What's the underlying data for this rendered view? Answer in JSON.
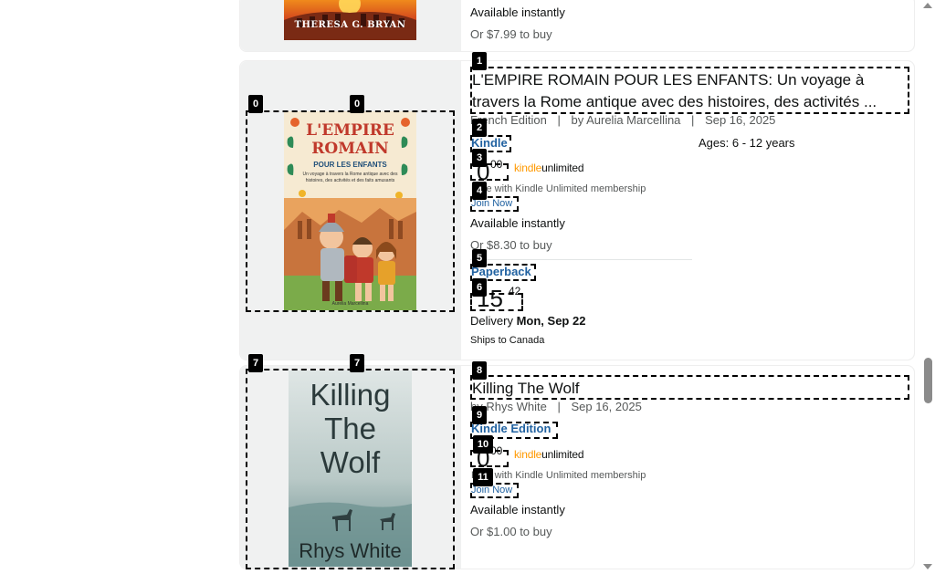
{
  "colors": {
    "link": "#2162a1",
    "ku_orange": "#ff9900",
    "annotation": "#000000"
  },
  "top_card": {
    "cover_author": "THERESA G. BRYAN",
    "availability": "Available instantly",
    "buy_line": "Or $7.99 to buy"
  },
  "card1": {
    "cover": {
      "title_l1": "L'EMPIRE",
      "title_l2": "ROMAIN",
      "subtitle": "POUR LES ENFANTS",
      "blurb": "Un voyage à travers la Rome antique avec des histoires, des activités et des faits amusants",
      "author": "Aurelia Marcellina"
    },
    "title": "L'EMPIRE ROMAIN POUR LES ENFANTS: Un voyage à travers la Rome antique avec des histoires, des activités ...",
    "edition": "French Edition",
    "sep": "|",
    "by_author": "by Aurelia Marcellina",
    "date": "Sep 16, 2025",
    "ages": "Ages: 6 - 12 years",
    "format1": "Kindle",
    "price1_whole": "0",
    "price1_frac": "00",
    "ku_kindle": "kindle",
    "ku_unlimited": "unlimited",
    "ku_note": "Free with Kindle Unlimited membership",
    "join": "Join Now",
    "availability": "Available instantly",
    "buy_line": "Or $8.30 to buy",
    "format2": "Paperback",
    "price2_whole": "15",
    "price2_frac": "42",
    "delivery_label": "Delivery",
    "delivery_date": "Mon, Sep 22",
    "ships": "Ships to Canada"
  },
  "card2": {
    "cover": {
      "title_l1": "Killing",
      "title_l2": "The",
      "title_l3": "Wolf",
      "author": "Rhys White"
    },
    "title": "Killing The Wolf",
    "by_author": "by Rhys White",
    "sep": "|",
    "date": "Sep 16, 2025",
    "format1": "Kindle Edition",
    "price1_whole": "0",
    "price1_frac": "00",
    "ku_kindle": "kindle",
    "ku_unlimited": "unlimited",
    "ku_note": "Free with Kindle Unlimited membership",
    "join": "Join Now",
    "availability": "Available instantly",
    "buy_line": "Or $1.00 to buy"
  },
  "tags": [
    "0",
    "0",
    "1",
    "2",
    "3",
    "4",
    "5",
    "6",
    "7",
    "7",
    "8",
    "9",
    "10",
    "11"
  ]
}
